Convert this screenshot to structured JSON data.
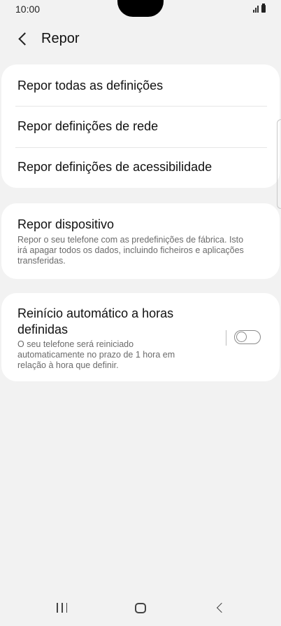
{
  "status_bar": {
    "time": "10:00"
  },
  "header": {
    "title": "Repor"
  },
  "reset_options": [
    {
      "label": "Repor todas as definições"
    },
    {
      "label": "Repor definições de rede"
    },
    {
      "label": "Repor definições de acessibilidade"
    }
  ],
  "factory_reset": {
    "title": "Repor dispositivo",
    "desc_lines": [
      "Repor o seu telefone com as predefinições de fábrica. Isto",
      "irá apagar todos os dados, incluindo ficheiros e aplicações",
      "transferidas."
    ]
  },
  "auto_restart": {
    "title_lines": [
      "Reinício automático a horas",
      "definidas"
    ],
    "desc_lines": [
      "O seu telefone será reiniciado",
      "automaticamente no prazo de 1 hora em",
      "relação à hora que definir."
    ],
    "enabled": false
  },
  "icons": {
    "back": "back-chevron-icon",
    "signal": "signal-icon",
    "battery": "battery-icon",
    "nav_recents": "recents-icon",
    "nav_home": "home-icon",
    "nav_back": "nav-back-icon"
  },
  "colors": {
    "background": "#f2f2f2",
    "card": "#ffffff",
    "secondary_text": "#6b6b6b"
  }
}
